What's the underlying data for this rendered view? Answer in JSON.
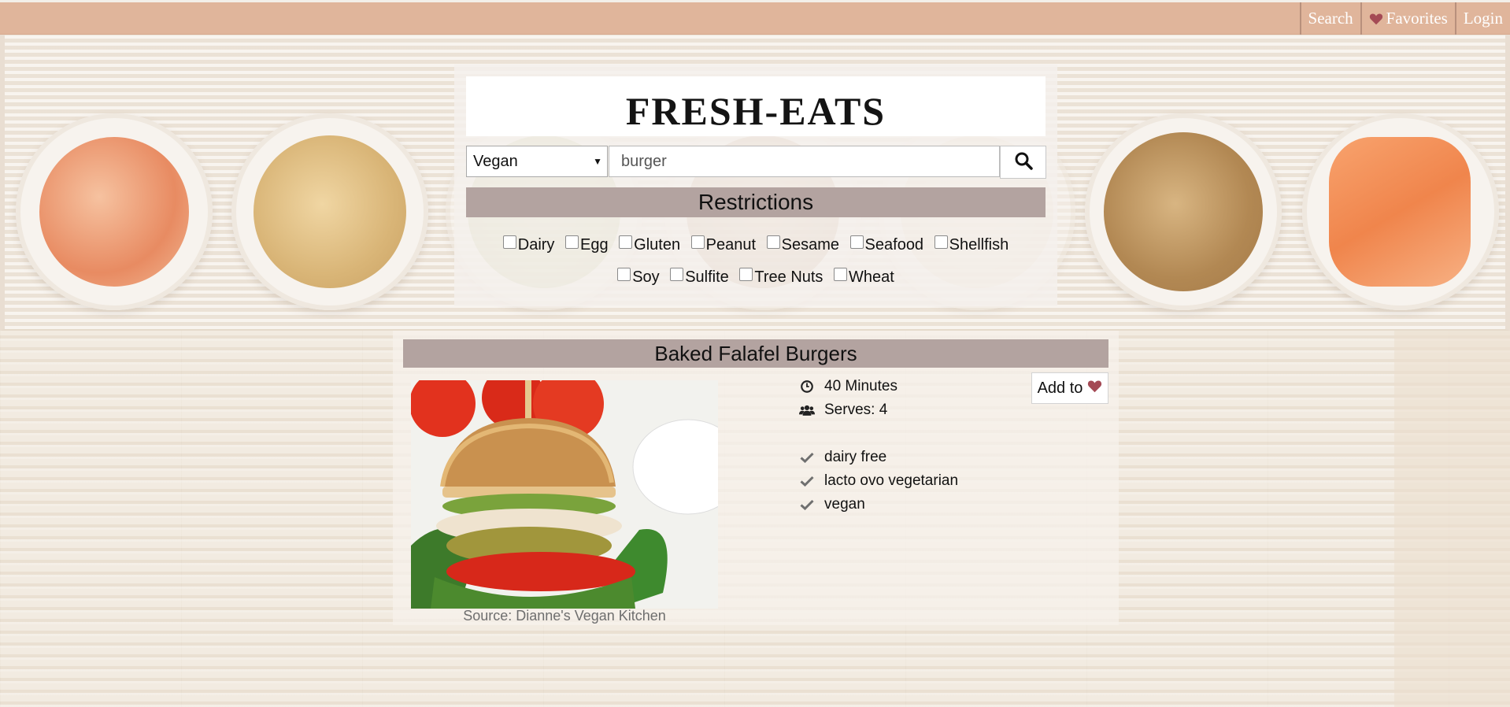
{
  "nav": {
    "items": [
      {
        "label": "Search",
        "icon": ""
      },
      {
        "label": "Favorites",
        "icon": "heart-icon"
      },
      {
        "label": "Login",
        "icon": ""
      }
    ]
  },
  "brand": {
    "logo": "FRESH-EATS"
  },
  "search": {
    "diet_selected": "Vegan",
    "query": "burger",
    "button_icon": "search-icon"
  },
  "restrictions": {
    "title": "Restrictions",
    "options": [
      "Dairy",
      "Egg",
      "Gluten",
      "Peanut",
      "Sesame",
      "Seafood",
      "Shellfish",
      "Soy",
      "Sulfite",
      "Tree Nuts",
      "Wheat"
    ]
  },
  "result": {
    "title": "Baked Falafel Burgers",
    "source": "Source: Dianne's Vegan Kitchen",
    "time": "40 Minutes",
    "serves": "Serves: 4",
    "add_label": "Add to",
    "labels": [
      "dairy free",
      "lacto ovo vegetarian",
      "vegan"
    ]
  },
  "colors": {
    "nav_bg": "#e0b59b",
    "bar_bg": "#b3a3a0",
    "heart": "#a44a55"
  }
}
